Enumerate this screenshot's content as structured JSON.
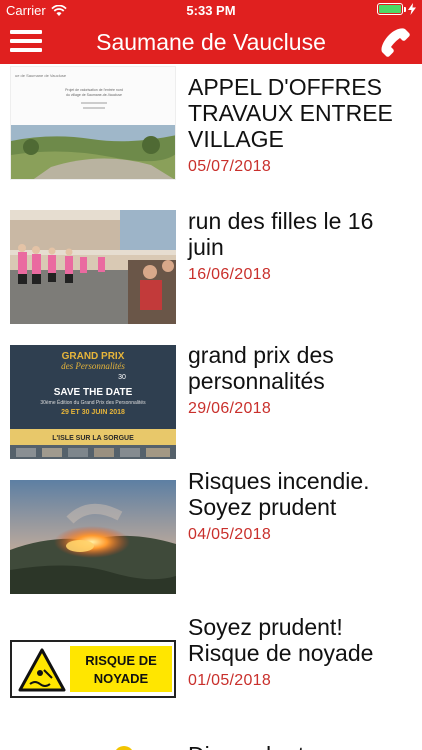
{
  "status_bar": {
    "carrier": "Carrier",
    "time": "5:33 PM",
    "battery_level": 1.0
  },
  "navbar": {
    "title": "Saumane de Vaucluse",
    "menu_icon": "hamburger-menu-icon",
    "phone_icon": "phone-icon"
  },
  "colors": {
    "brand_red": "#e0201f",
    "date_red": "#c9302c"
  },
  "news": [
    {
      "title": "APPEL D'OFFRES TRAVAUX ENTREE VILLAGE",
      "date": "05/07/2018",
      "thumb": "document-village-photo"
    },
    {
      "title": "run des filles le 16 juin",
      "date": "16/06/2018",
      "thumb": "runners-street-photo"
    },
    {
      "title": "grand prix des personnalités",
      "date": "29/06/2018",
      "thumb": "grand-prix-poster"
    },
    {
      "title": "Risques incendie. Soyez prudent",
      "date": "04/05/2018",
      "thumb": "forest-fire-photo"
    },
    {
      "title": "Soyez prudent! Risque de noyade",
      "date": "01/05/2018",
      "thumb": "drowning-risk-sign"
    }
  ],
  "thumb_text": {
    "doc_header": "ue de Saumane de Vaucluse",
    "doc_line1": "Projet de valorisation de l'entrée nord",
    "doc_line2": "du village de Saumane-de-Vaucluse",
    "poster_title1": "GRAND PRIX",
    "poster_title2": "des Personnalités",
    "poster_num": "30",
    "poster_save": "SAVE THE DATE",
    "poster_edition": "30ème Édition du Grand Prix des Personnalités",
    "poster_dates": "29 ET 30 JUIN 2018",
    "poster_place": "L'ISLE SUR LA SORGUE",
    "sign_line1": "RISQUE DE",
    "sign_line2": "NOYADE"
  },
  "partial_item": {
    "title": "Dimanche ta"
  }
}
